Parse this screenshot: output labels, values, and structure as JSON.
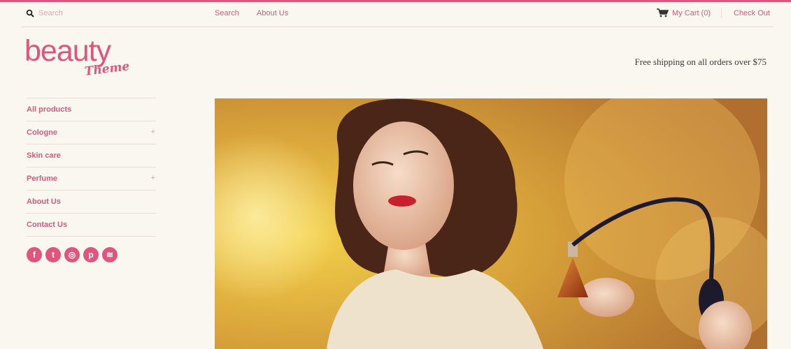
{
  "colors": {
    "accent": "#e0557e",
    "background": "#faf6f0"
  },
  "topbar": {
    "search_placeholder": "Search",
    "nav": [
      {
        "label": "Search"
      },
      {
        "label": "About Us"
      }
    ],
    "cart_label": "My Cart (0)",
    "checkout_label": "Check Out"
  },
  "logo": {
    "word": "beauty",
    "script": "Theme"
  },
  "header": {
    "shipping_text": "Free shipping on all orders over $75"
  },
  "sidebar": {
    "items": [
      {
        "label": "All products",
        "expandable": false
      },
      {
        "label": "Cologne",
        "expandable": true,
        "toggle": "+"
      },
      {
        "label": "Skin care",
        "expandable": false
      },
      {
        "label": "Perfume",
        "expandable": true,
        "toggle": "+"
      },
      {
        "label": "About Us",
        "expandable": false
      },
      {
        "label": "Contact Us",
        "expandable": false
      }
    ]
  },
  "social": {
    "icons": [
      "facebook-icon",
      "twitter-icon",
      "instagram-icon",
      "pinterest-icon",
      "rss-icon"
    ],
    "glyphs": [
      "f",
      "t",
      "◎",
      "p",
      "≋"
    ]
  },
  "hero": {
    "icon": "hero-image"
  }
}
